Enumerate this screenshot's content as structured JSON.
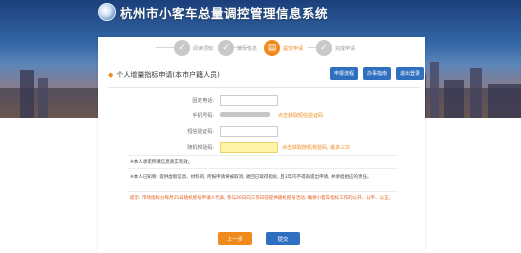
{
  "header": {
    "site_title": "杭州市小客车总量调控管理信息系统"
  },
  "steps": [
    {
      "label": "阅读须知",
      "state": "done",
      "icon": "check-icon"
    },
    {
      "label": "填写信息",
      "state": "done",
      "icon": "check-icon"
    },
    {
      "label": "提交申请",
      "state": "active",
      "icon": "form-icon"
    },
    {
      "label": "完成申请",
      "state": "pending",
      "icon": "check-icon"
    }
  ],
  "form": {
    "title": "个人增量指标申请(本市户籍人员)",
    "buttons": {
      "flow": "申报流程",
      "faq": "办事指南",
      "logout": "退出登录"
    },
    "fields": [
      {
        "label": "固定电话:",
        "value": "",
        "placeholder": ""
      },
      {
        "label": "手机号码:",
        "value": "",
        "link": "点击获取短信验证码"
      },
      {
        "label": "短信验证码:",
        "value": "",
        "placeholder": ""
      },
      {
        "label": "随机校验码:",
        "value": "",
        "link": "点击获取随机校验码, 最多三次"
      }
    ]
  },
  "notes": {
    "n1": "※本人承诺所填信息真实有效。",
    "n2": "※本人已知晓: 提供虚假信息、材料的, 所报申请将被取消, 收回已取得指标, 且3年内不得再提出申请, 并承担相应的责任。",
    "n3": "提示: 市场指标分每月25日随机摇号申请人代表, 参与26日向工作日前提供随机摇号活动, 确保小客车指标工作的公开、公平、公正。"
  },
  "actions": {
    "prev": "上一步",
    "submit": "提交"
  },
  "colors": {
    "accent_orange": "#f08a1c",
    "accent_blue": "#2f6fbf",
    "highlight_field": "#fff3a8"
  }
}
